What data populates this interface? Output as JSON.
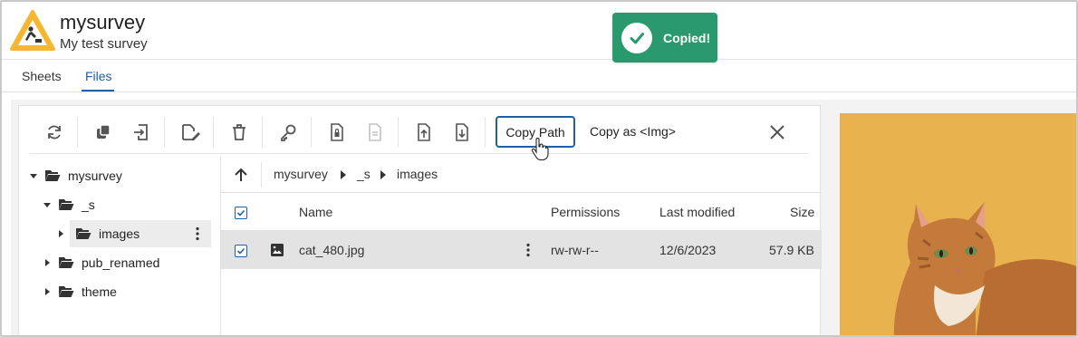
{
  "app": {
    "title": "mysurvey",
    "subtitle": "My test survey"
  },
  "toast": {
    "message": "Copied!",
    "color": "#2a9a6e"
  },
  "tabs": [
    {
      "label": "Sheets",
      "active": false
    },
    {
      "label": "Files",
      "active": true
    }
  ],
  "toolbar": {
    "icons": [
      "refresh-icon",
      "duplicate-icon",
      "import-icon",
      "rename-icon",
      "delete-icon",
      "key-icon",
      "file-lock-icon",
      "file-text-icon",
      "upload-icon",
      "download-icon"
    ],
    "copy_path_label": "Copy Path",
    "copy_img_label": "Copy as <Img>"
  },
  "tree": {
    "items": [
      {
        "label": "mysurvey",
        "expanded": true
      },
      {
        "label": "_s",
        "expanded": true
      },
      {
        "label": "images",
        "expanded": false,
        "selected": true
      },
      {
        "label": "pub_renamed",
        "expanded": false
      },
      {
        "label": "theme",
        "expanded": false
      }
    ]
  },
  "breadcrumb": [
    "mysurvey",
    "_s",
    "images"
  ],
  "table": {
    "columns": [
      "Name",
      "Permissions",
      "Last modified",
      "Size"
    ],
    "rows": [
      {
        "name": "cat_480.jpg",
        "permissions": "rw-rw-r--",
        "modified": "12/6/2023",
        "size": "57.9 KB",
        "checked": true
      }
    ]
  },
  "colors": {
    "accent": "#1f5fa3",
    "logo_yellow": "#f5b731"
  }
}
